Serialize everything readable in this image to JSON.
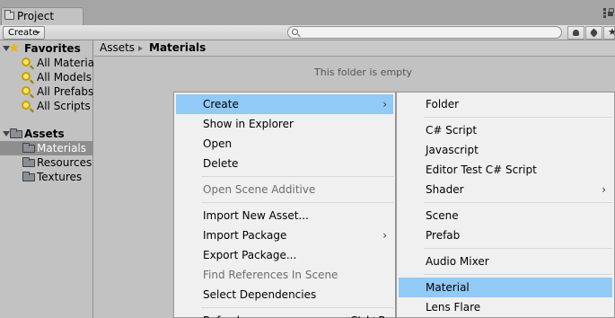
{
  "window": {
    "tab_label": "Project"
  },
  "toolbar": {
    "create_label": "Create",
    "search_placeholder": ""
  },
  "tree": {
    "favorites_label": "Favorites",
    "favorites": [
      "All Materials",
      "All Models",
      "All Prefabs",
      "All Scripts"
    ],
    "assets_label": "Assets",
    "folders": [
      "Materials",
      "Resources",
      "Textures"
    ],
    "selected": "Materials"
  },
  "breadcrumb": {
    "root": "Assets",
    "current": "Materials"
  },
  "main": {
    "empty_message": "This folder is empty"
  },
  "context_menu": {
    "items": [
      "Create",
      "Show in Explorer",
      "Open",
      "Delete",
      "Open Scene Additive",
      "Import New Asset...",
      "Import Package",
      "Export Package...",
      "Find References In Scene",
      "Select Dependencies",
      "Refresh",
      "Ctrl+R"
    ]
  },
  "create_submenu": {
    "items": [
      "Folder",
      "C# Script",
      "Javascript",
      "Editor Test C# Script",
      "Shader",
      "Scene",
      "Prefab",
      "Audio Mixer",
      "Material",
      "Lens Flare"
    ]
  },
  "colors": {
    "highlight": "#91c9f7",
    "panel": "#c2c2c2",
    "menu_bg": "#f0f0f0",
    "selection": "#8e8e8e"
  }
}
